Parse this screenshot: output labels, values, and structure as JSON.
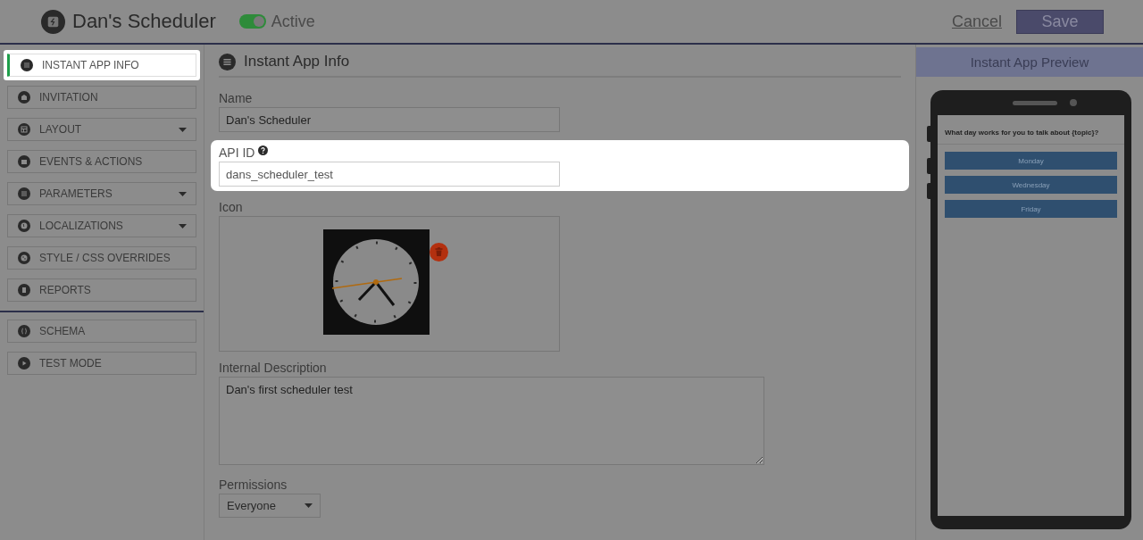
{
  "header": {
    "title": "Dan's Scheduler",
    "status": {
      "label": "Active",
      "on": true
    },
    "cancel": "Cancel",
    "save": "Save"
  },
  "sidebar": {
    "groups": [
      {
        "items": [
          {
            "label": "INSTANT APP INFO",
            "dropdown": false,
            "selected": true,
            "highlighted": true
          },
          {
            "label": "INVITATION",
            "dropdown": false,
            "selected": false,
            "highlighted": false
          },
          {
            "label": "LAYOUT",
            "dropdown": true,
            "selected": false,
            "highlighted": false
          },
          {
            "label": "EVENTS & ACTIONS",
            "dropdown": false,
            "selected": false,
            "highlighted": false
          },
          {
            "label": "PARAMETERS",
            "dropdown": true,
            "selected": false,
            "highlighted": false
          },
          {
            "label": "LOCALIZATIONS",
            "dropdown": true,
            "selected": false,
            "highlighted": false
          },
          {
            "label": "STYLE / CSS OVERRIDES",
            "dropdown": false,
            "selected": false,
            "highlighted": false
          },
          {
            "label": "REPORTS",
            "dropdown": false,
            "selected": false,
            "highlighted": false
          }
        ]
      },
      {
        "items": [
          {
            "label": "SCHEMA",
            "dropdown": false,
            "selected": false,
            "highlighted": false
          },
          {
            "label": "TEST MODE",
            "dropdown": false,
            "selected": false,
            "highlighted": false
          }
        ]
      }
    ]
  },
  "main": {
    "heading": "Instant App Info",
    "fields": [
      {
        "kind": "text",
        "label": "Name",
        "value": "Dan's Scheduler",
        "highlighted": false
      },
      {
        "kind": "text",
        "label": "API ID",
        "value": "dans_scheduler_test",
        "help": true,
        "highlighted": true
      },
      {
        "label": "Icon"
      },
      {
        "kind": "textarea",
        "label": "Internal Description",
        "value": "Dan's first scheduler test"
      },
      {
        "kind": "select",
        "label": "Permissions",
        "value": "Everyone"
      }
    ]
  },
  "preview": {
    "title": "Instant App Preview",
    "question": "What day works for you to talk about {topic}?",
    "options": [
      "Monday",
      "Wednesday",
      "Friday"
    ]
  }
}
